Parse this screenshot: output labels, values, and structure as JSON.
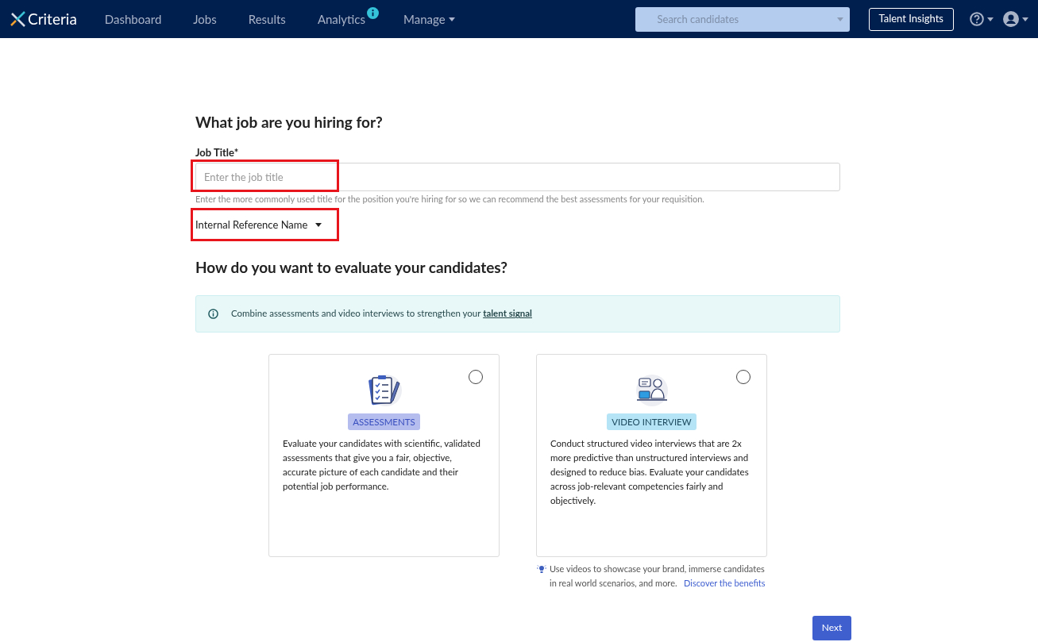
{
  "nav": {
    "logo": "Criteria",
    "items": [
      {
        "label": "Dashboard",
        "kind": "link"
      },
      {
        "label": "Jobs",
        "kind": "link"
      },
      {
        "label": "Results",
        "kind": "link"
      },
      {
        "label": "Analytics",
        "kind": "info"
      },
      {
        "label": "Manage",
        "kind": "dropdown"
      }
    ],
    "search": {
      "placeholder": "Search candidates"
    },
    "insights_button": "Talent Insights"
  },
  "job": {
    "heading": "What job are you hiring for?",
    "label": "Job Title*",
    "placeholder": "Enter the job title",
    "highlighted": true,
    "hint": "Enter the more commonly used title for the position you're hiring for so we can recommend the best assessments for your requisition.",
    "reference": {
      "label": "Internal Reference Name",
      "highlighted": true
    }
  },
  "evaluate": {
    "heading": "How do you want to evaluate your candidates?",
    "notice": {
      "text": "Combine assessments and video interviews to strengthen your",
      "link": "talent signal"
    },
    "options": [
      {
        "kind": "assessments",
        "tag": "ASSESSMENTS",
        "description": "Evaluate your candidates with scientific, validated assessments that give you a fair, objective, accurate picture of each candidate and their potential job performance.",
        "selected": false
      },
      {
        "kind": "video",
        "tag": "VIDEO INTERVIEW",
        "description": "Conduct structured video interviews that are 2x more predictive than unstructured interviews and designed to reduce bias. Evaluate your candidates across job-relevant competencies fairly and objectively.",
        "selected": false
      }
    ],
    "tip": {
      "text": "Use videos to showcase your brand, immerse candidates in real world scenarios, and more.",
      "link": "Discover the benefits"
    }
  },
  "next_button": "Next"
}
